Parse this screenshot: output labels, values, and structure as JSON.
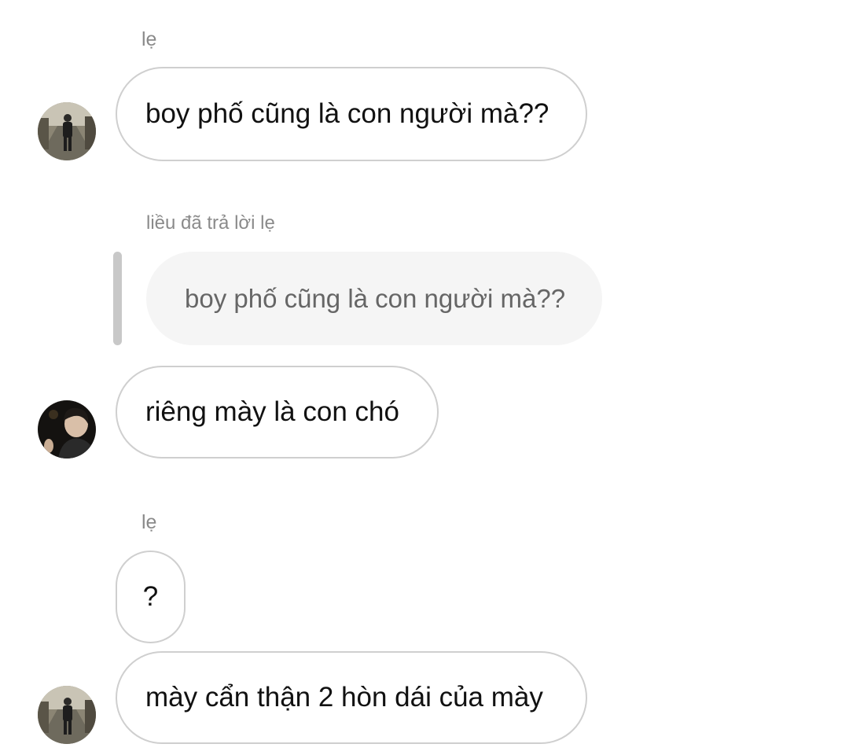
{
  "thread": {
    "group1": {
      "sender": "lẹ",
      "avatar_icon": "street-photo-avatar-icon",
      "message": "boy phố cũng là con người mà??"
    },
    "reply_context": {
      "label": "liều đã trả lời lẹ",
      "quoted_text": "boy phố cũng là con người mà??"
    },
    "group2": {
      "avatar_icon": "selfie-avatar-icon",
      "message": "riêng mày là con chó"
    },
    "group3": {
      "sender": "lẹ",
      "message1": "?",
      "message2": "mày cẩn thận 2 hòn dái của mày",
      "avatar_icon": "street-photo-avatar-icon"
    }
  },
  "colors": {
    "bubble_border": "#cfcfcf",
    "quoted_background": "#f5f5f5",
    "meta_text": "#8a8a8a"
  }
}
